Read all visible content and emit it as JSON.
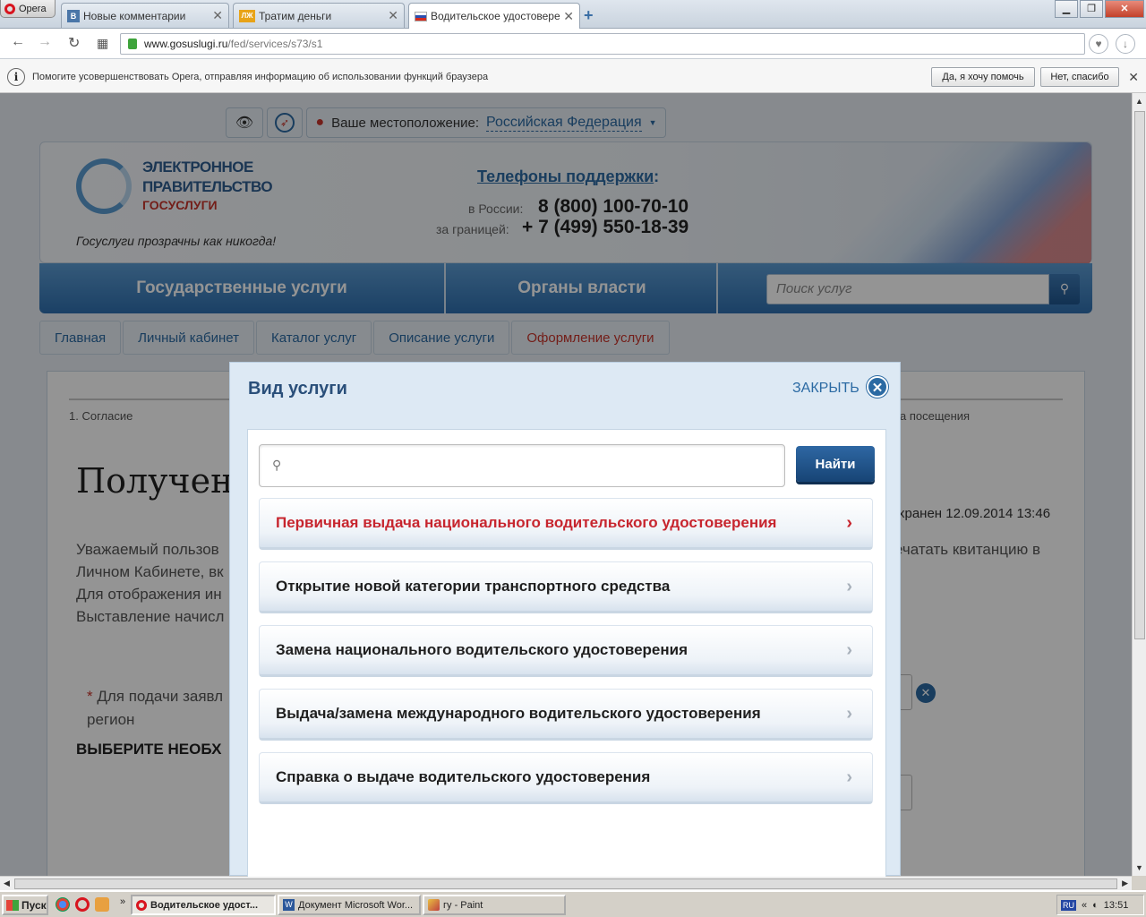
{
  "browser": {
    "app_name": "Opera",
    "tabs": [
      {
        "label": "Новые комментарии",
        "favicon": "vk-icon",
        "favicon_text": "B",
        "favicon_color": "#4a76a8"
      },
      {
        "label": "Тратим деньги",
        "favicon": "lj-icon",
        "favicon_text": "ЛЖ",
        "favicon_color": "#e8a317"
      },
      {
        "label": "Водительское удостоверен",
        "favicon": "russia-flag-icon",
        "active": true
      }
    ],
    "url_host": "www.gosuslugi.ru",
    "url_path": "/fed/services/s73/s1",
    "infobar": {
      "text": "Помогите усовершенствовать Opera, отправляя информацию об использовании функций браузера",
      "accept": "Да, я хочу помочь",
      "decline": "Нет, спасибо"
    }
  },
  "site": {
    "location_label": "Ваше местоположение:",
    "location_value": "Российская Федерация",
    "logo": {
      "line1": "ЭЛЕКТРОННОЕ",
      "line2": "ПРАВИТЕЛЬСТВО",
      "line3": "ГОСУСЛУГИ",
      "slogan": "Госуслуги прозрачны как никогда!"
    },
    "support": {
      "title": "Телефоны поддержки",
      "russia_label": "в России:",
      "russia_phone": "8 (800) 100-70-10",
      "abroad_label": "за границей:",
      "abroad_phone": "+ 7 (499) 550-18-39"
    },
    "nav": {
      "services": "Государственные услуги",
      "authorities": "Органы власти",
      "search_placeholder": "Поиск услуг"
    },
    "breadcrumbs": [
      "Главная",
      "Личный кабинет",
      "Каталог услуг",
      "Описание услуги",
      "Оформление услуги"
    ],
    "background": {
      "step1": "1. Согласие",
      "step_right": "а посещения",
      "title": "Получени",
      "para_lines": [
        "Уважаемый пользов",
        "Личном Кабинете, вк",
        "Для отображения ин",
        "Выставление начисл"
      ],
      "para_right": "ечатать квитанцию в",
      "saved": "хранен 12.09.2014 13:46",
      "req_line1": "Для подачи заявл",
      "req_line2": "регион",
      "choose": "ВЫБЕРИТЕ НЕОБХ"
    }
  },
  "modal": {
    "title": "Вид услуги",
    "close_label": "ЗАКРЫТЬ",
    "search_value": "",
    "find_button": "Найти",
    "services": [
      {
        "label": "Первичная выдача национального водительского удостоверения",
        "highlighted": true
      },
      {
        "label": "Открытие новой категории транспортного средства",
        "highlighted": false
      },
      {
        "label": "Замена национального водительского удостоверения",
        "highlighted": false
      },
      {
        "label": "Выдача/замена международного водительского удостоверения",
        "highlighted": false
      },
      {
        "label": "Справка о выдаче водительского удостоверения",
        "highlighted": false
      }
    ]
  },
  "taskbar": {
    "start": "Пуск",
    "tasks": [
      {
        "label": "Водительское удост...",
        "active": true
      },
      {
        "label": "Документ Microsoft Wor...",
        "active": false
      },
      {
        "label": "гу - Paint",
        "active": false
      }
    ],
    "lang": "RU",
    "clock": "13:51"
  },
  "colors": {
    "accent": "#2b6aa3",
    "highlight": "#c7252e",
    "nav": "#2f6fae"
  }
}
